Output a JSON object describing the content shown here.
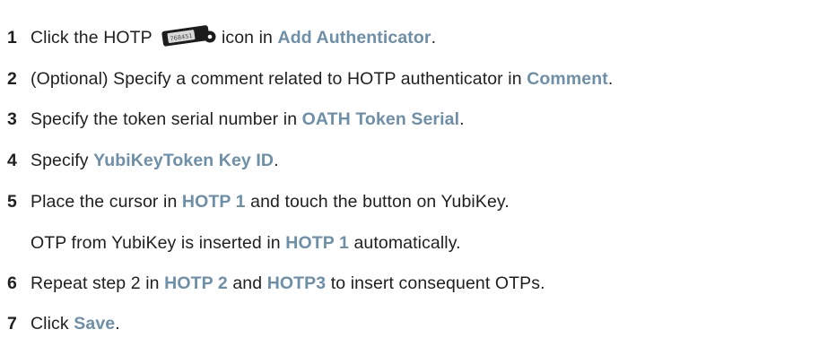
{
  "steps": [
    {
      "number": "1",
      "parts": [
        {
          "t": "Click the HOTP",
          "ui": false
        },
        {
          "t": "icon",
          "ui": false,
          "icon": "hotp-token-icon"
        },
        {
          "t": "icon in ",
          "ui": false
        },
        {
          "t": "Add Authenticator",
          "ui": true
        },
        {
          "t": ".",
          "ui": false
        }
      ]
    },
    {
      "number": "2",
      "parts": [
        {
          "t": "(Optional) Specify a comment related to HOTP authenticator in ",
          "ui": false
        },
        {
          "t": "Comment",
          "ui": true
        },
        {
          "t": ".",
          "ui": false
        }
      ]
    },
    {
      "number": "3",
      "parts": [
        {
          "t": "Specify the token serial number in ",
          "ui": false
        },
        {
          "t": "OATH Token Serial",
          "ui": true
        },
        {
          "t": ".",
          "ui": false
        }
      ]
    },
    {
      "number": "4",
      "parts": [
        {
          "t": "Specify ",
          "ui": false
        },
        {
          "t": "YubiKeyToken Key ID",
          "ui": true
        },
        {
          "t": ".",
          "ui": false
        }
      ]
    },
    {
      "number": "5",
      "parts": [
        {
          "t": "Place the cursor in ",
          "ui": false
        },
        {
          "t": "HOTP 1",
          "ui": true
        },
        {
          "t": " and touch the button on YubiKey.",
          "ui": false
        }
      ]
    },
    {
      "number": "",
      "parts": [
        {
          "t": "OTP from YubiKey is inserted in ",
          "ui": false
        },
        {
          "t": "HOTP 1",
          "ui": true
        },
        {
          "t": " automatically.",
          "ui": false
        }
      ]
    },
    {
      "number": "6",
      "parts": [
        {
          "t": "Repeat step 2 in ",
          "ui": false
        },
        {
          "t": "HOTP 2",
          "ui": true
        },
        {
          "t": " and ",
          "ui": false
        },
        {
          "t": "HOTP3",
          "ui": true
        },
        {
          "t": " to insert consequent OTPs.",
          "ui": false
        }
      ]
    },
    {
      "number": "7",
      "parts": [
        {
          "t": "Click ",
          "ui": false
        },
        {
          "t": "Save",
          "ui": true
        },
        {
          "t": ".",
          "ui": false
        }
      ]
    }
  ],
  "token_icon_label": "768451",
  "colors": {
    "text": "#1f1f1f",
    "ui_term": "#6e8fa8",
    "token_body": "#1c1c1c",
    "token_label": "#d9d9d9"
  }
}
